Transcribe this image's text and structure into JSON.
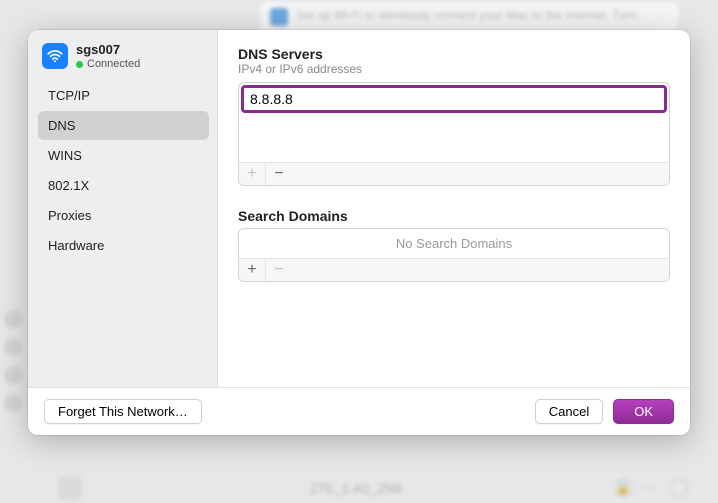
{
  "backdrop": {
    "hint_text": "Set up Wi-Fi to wirelessly connect your Mac to the internet. Turn",
    "other_network": "ZTE_2.4G_ZN9"
  },
  "connection": {
    "name": "sgs007",
    "status": "Connected"
  },
  "sidebar": {
    "items": [
      {
        "label": "TCP/IP",
        "selected": false
      },
      {
        "label": "DNS",
        "selected": true
      },
      {
        "label": "WINS",
        "selected": false
      },
      {
        "label": "802.1X",
        "selected": false
      },
      {
        "label": "Proxies",
        "selected": false
      },
      {
        "label": "Hardware",
        "selected": false
      }
    ]
  },
  "dns": {
    "title": "DNS Servers",
    "subtitle": "IPv4 or IPv6 addresses",
    "entries": [
      "8.8.8.8"
    ],
    "add_label": "+",
    "remove_label": "−"
  },
  "search_domains": {
    "title": "Search Domains",
    "empty_text": "No Search Domains",
    "add_label": "+",
    "remove_label": "−"
  },
  "footer": {
    "forget": "Forget This Network…",
    "cancel": "Cancel",
    "ok": "OK"
  }
}
